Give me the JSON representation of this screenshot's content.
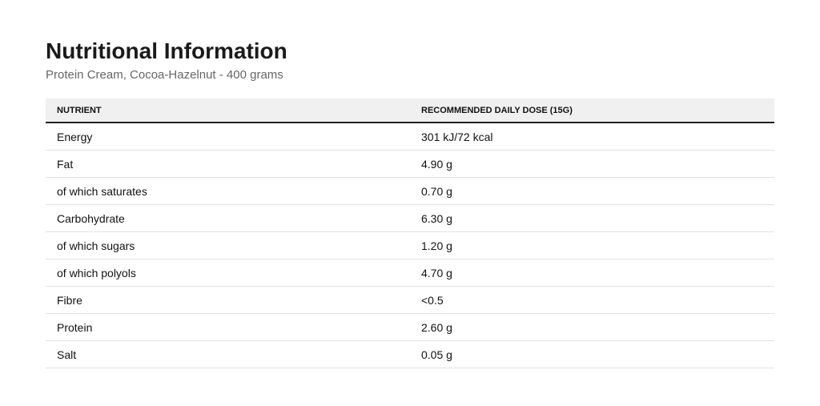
{
  "header": {
    "title": "Nutritional Information",
    "subtitle": "Protein Cream, Cocoa-Hazelnut - 400 grams"
  },
  "table": {
    "columns": [
      "Nutrient",
      "Recommended Daily Dose (15g)"
    ],
    "rows": [
      {
        "nutrient": "Energy",
        "value": "301 kJ/72 kcal"
      },
      {
        "nutrient": "Fat",
        "value": "4.90 g"
      },
      {
        "nutrient": "of which saturates",
        "value": "0.70 g"
      },
      {
        "nutrient": "Carbohydrate",
        "value": "6.30 g"
      },
      {
        "nutrient": "of which sugars",
        "value": "1.20 g"
      },
      {
        "nutrient": "of which polyols",
        "value": "4.70 g"
      },
      {
        "nutrient": "Fibre",
        "value": "<0.5"
      },
      {
        "nutrient": "Protein",
        "value": "2.60 g"
      },
      {
        "nutrient": "Salt",
        "value": "0.05 g"
      }
    ]
  }
}
